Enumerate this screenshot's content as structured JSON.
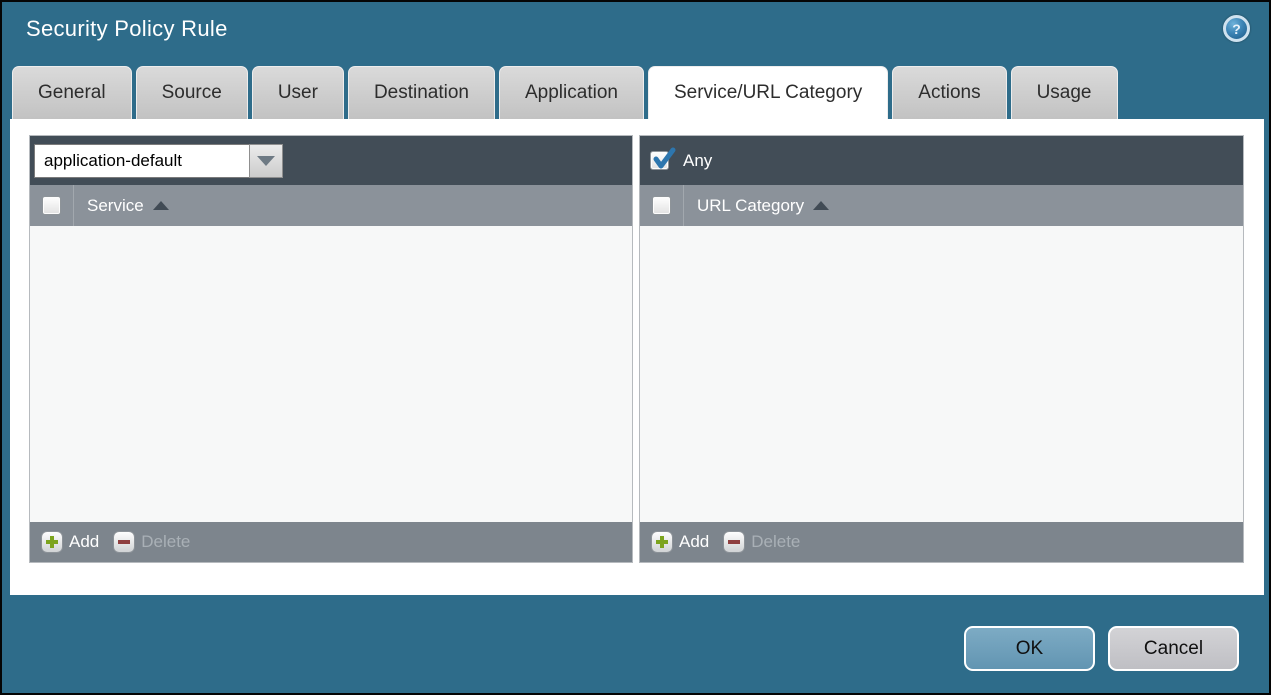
{
  "window": {
    "title": "Security Policy Rule"
  },
  "icons": {
    "help_glyph": "?"
  },
  "tabs": [
    {
      "label": "General"
    },
    {
      "label": "Source"
    },
    {
      "label": "User"
    },
    {
      "label": "Destination"
    },
    {
      "label": "Application"
    },
    {
      "label": "Service/URL Category",
      "active": true
    },
    {
      "label": "Actions"
    },
    {
      "label": "Usage"
    }
  ],
  "service_panel": {
    "dropdown_value": "application-default",
    "column_header": "Service",
    "sort": "ascending",
    "select_all_checked": false,
    "rows": [],
    "add_label": "Add",
    "delete_label": "Delete",
    "delete_enabled": false
  },
  "url_category_panel": {
    "any_label": "Any",
    "any_checked": true,
    "column_header": "URL Category",
    "sort": "ascending",
    "select_all_checked": false,
    "rows": [],
    "add_label": "Add",
    "delete_label": "Delete",
    "delete_enabled": false
  },
  "dialog_buttons": {
    "ok": "OK",
    "cancel": "Cancel"
  },
  "colors": {
    "background": "#2e6c8a",
    "panel_header": "#424d57",
    "column_header": "#8b929a",
    "panel_footer": "#7d858d",
    "active_tab": "#ffffff",
    "inactive_tab": "#cccccc",
    "add_plus": "#7ca41e",
    "delete_minus": "#8f4040",
    "checkmark": "#2d76ae",
    "ok_button": "#6fa1bc",
    "cancel_button": "#c9c9cd"
  }
}
